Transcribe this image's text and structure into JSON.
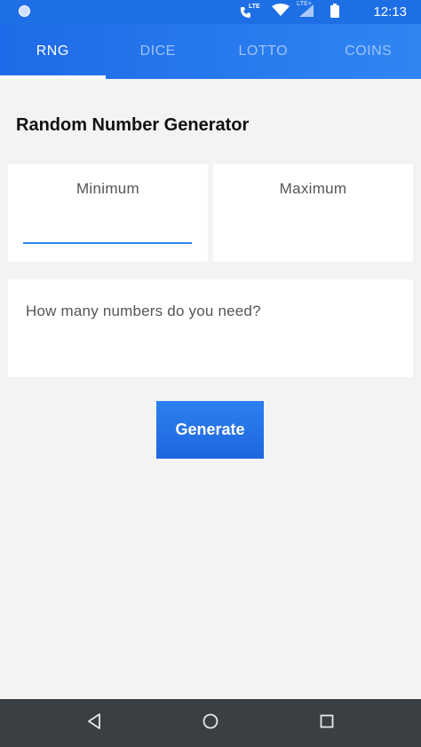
{
  "status_bar": {
    "time": "12:13",
    "network_primary": "LTE",
    "network_secondary": "LTE+",
    "icons": [
      "notification-dot-icon",
      "phone-lte-icon",
      "wifi-icon",
      "signal-icon",
      "battery-icon"
    ]
  },
  "tabs": [
    {
      "label": "RNG",
      "active": true
    },
    {
      "label": "DICE",
      "active": false
    },
    {
      "label": "LOTTO",
      "active": false
    },
    {
      "label": "COINS",
      "active": false
    }
  ],
  "page": {
    "title": "Random Number Generator"
  },
  "form": {
    "minimum": {
      "label": "Minimum",
      "value": ""
    },
    "maximum": {
      "label": "Maximum",
      "value": ""
    },
    "count": {
      "placeholder": "How many numbers do you need?",
      "value": ""
    },
    "generate_label": "Generate"
  },
  "colors": {
    "accent": "#1f6ae8",
    "tab_inactive": "#9ec3f7",
    "background": "#f3f3f3",
    "navbar": "#3a3f44"
  },
  "nav_bar": {
    "buttons": [
      "back-icon",
      "home-icon",
      "recents-icon"
    ]
  }
}
